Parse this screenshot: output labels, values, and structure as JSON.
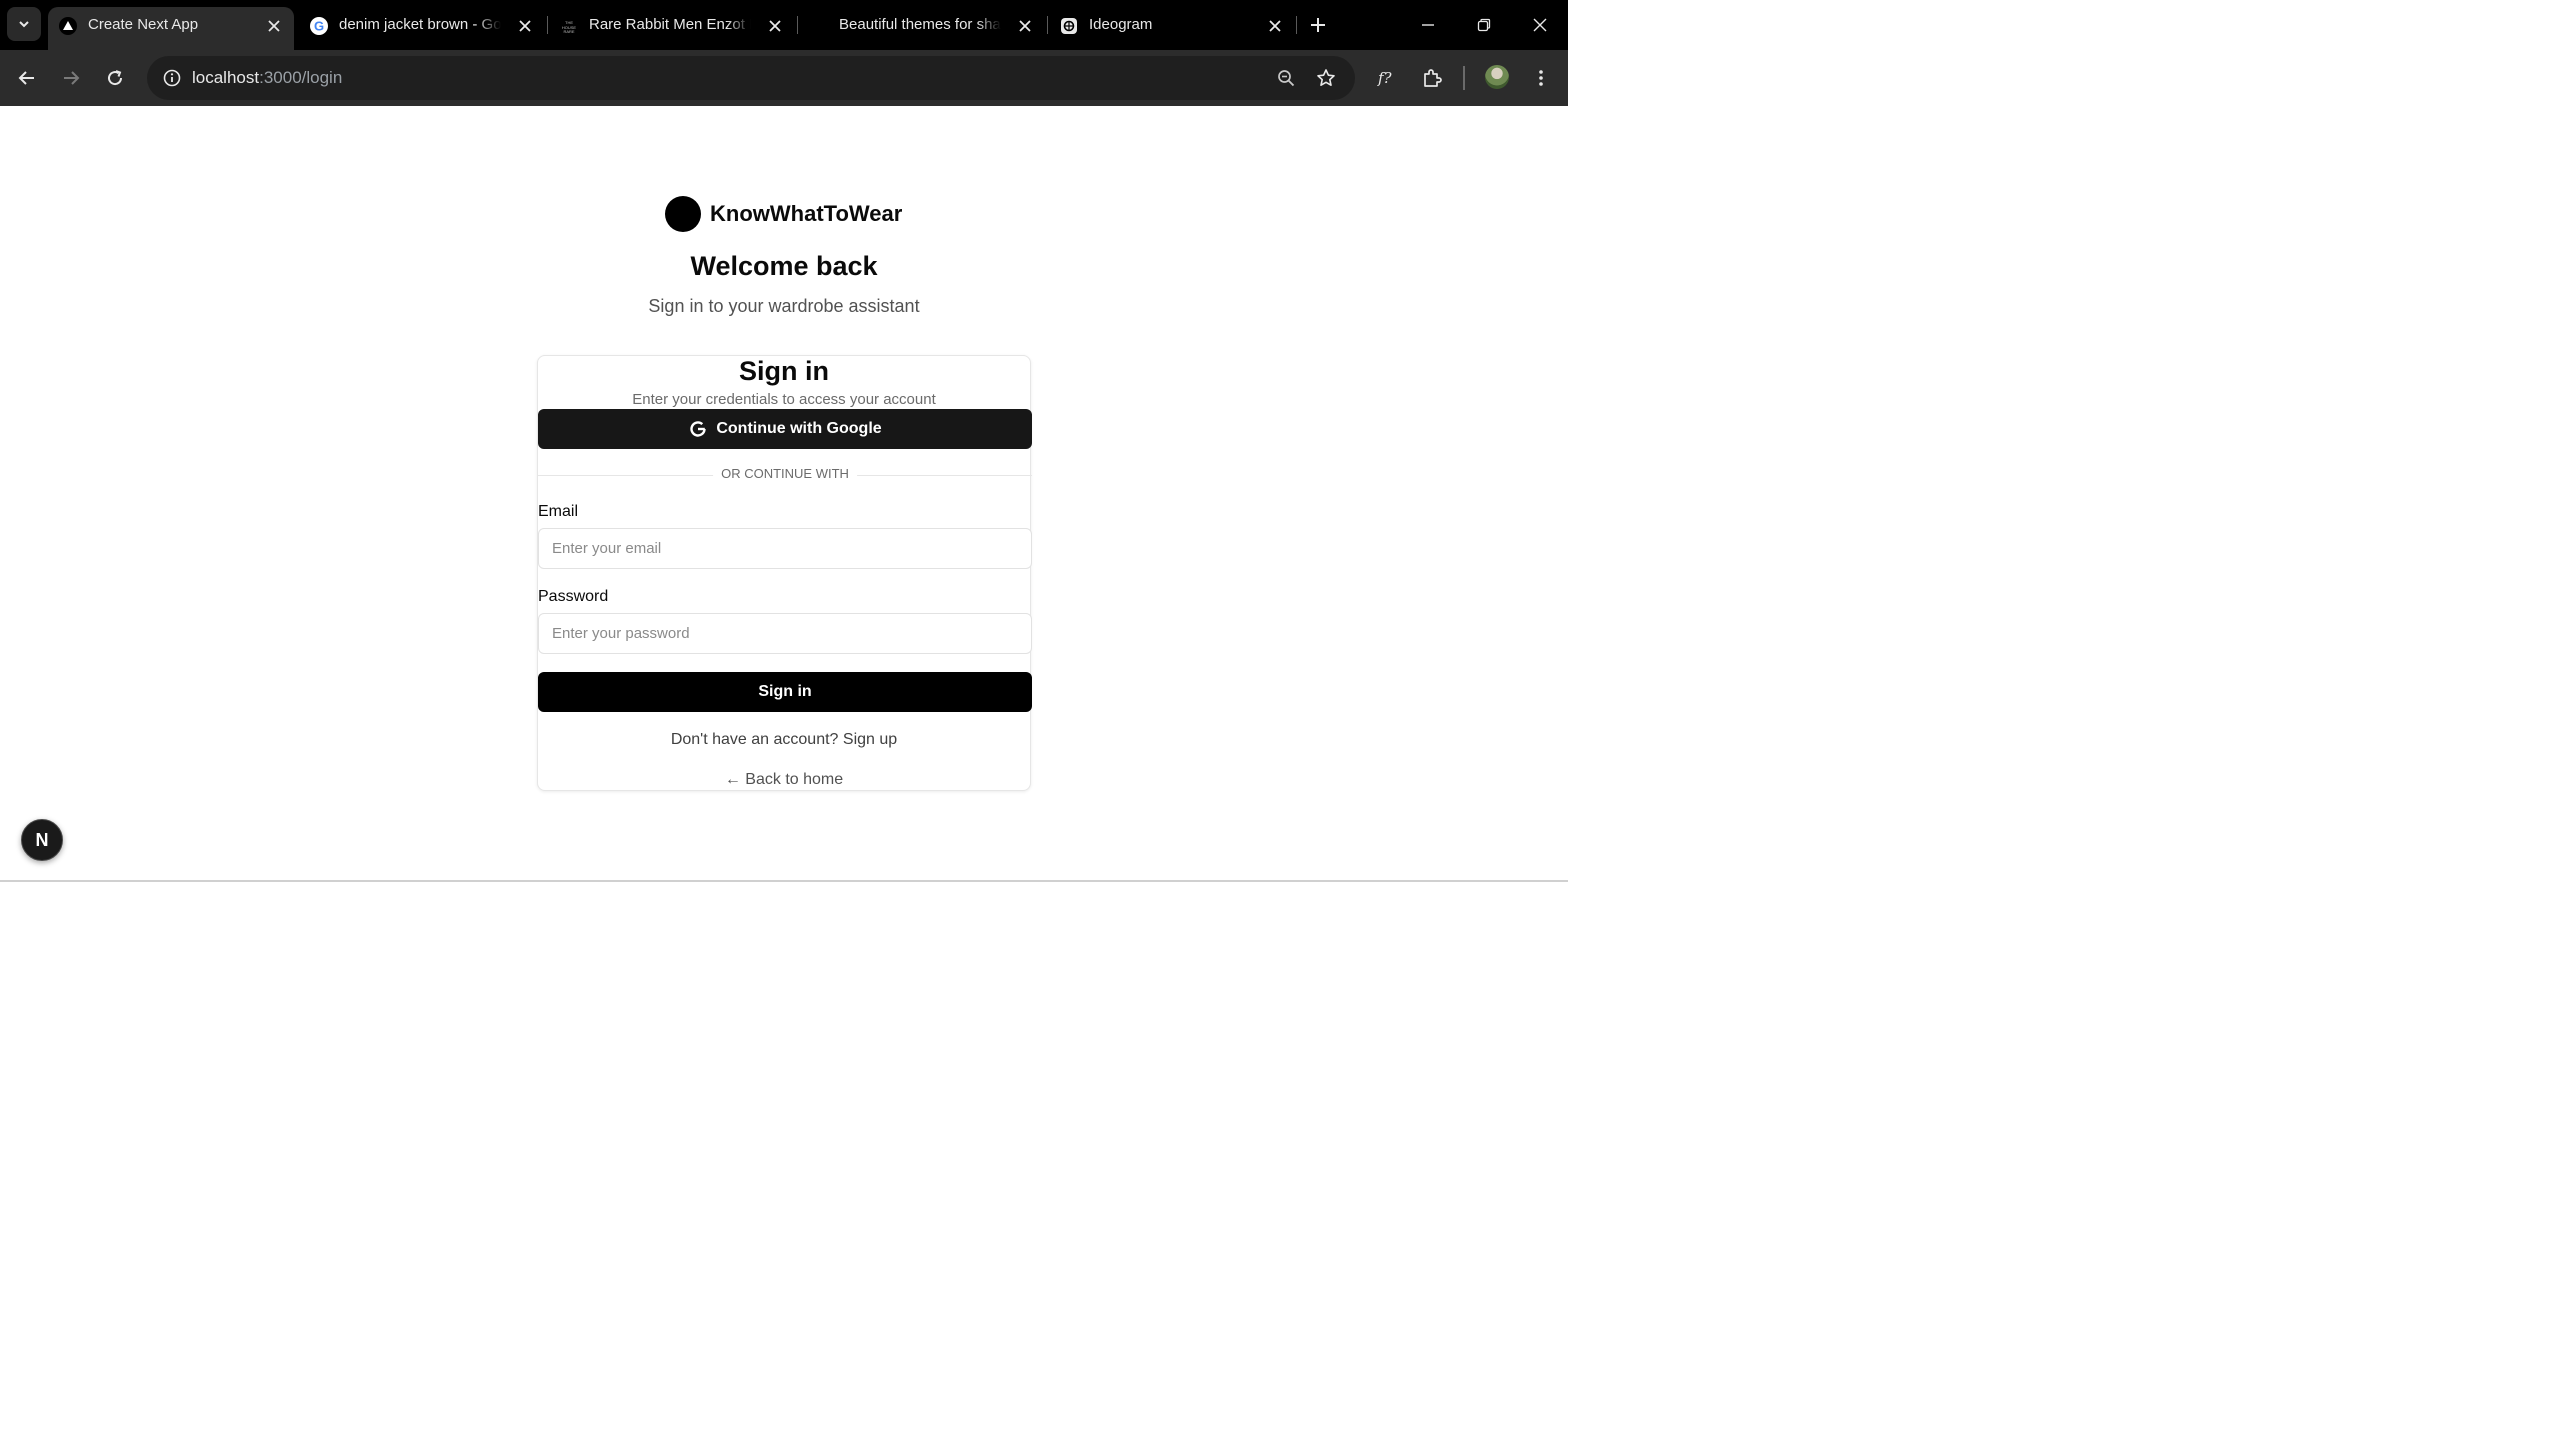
{
  "browser": {
    "tabs": [
      {
        "title": "Create Next App",
        "favicon": "vercel-triangle-icon",
        "active": true
      },
      {
        "title": "denim jacket brown - Go",
        "favicon": "google-g-icon",
        "active": false
      },
      {
        "title": "Rare Rabbit Men Enzot B",
        "favicon": "house-of-rare-icon",
        "active": false
      },
      {
        "title": "Beautiful themes for sha",
        "favicon": "",
        "active": false
      },
      {
        "title": "Ideogram",
        "favicon": "ideogram-icon",
        "active": false
      }
    ],
    "address": {
      "host": "localhost",
      "path": ":3000/login"
    },
    "colors": {
      "tabstrip": "#000000",
      "toolbar": "#2c2c2c",
      "omnibox": "#1f1f1f"
    }
  },
  "page": {
    "brand_name": "KnowWhatToWear",
    "welcome_title": "Welcome back",
    "welcome_subtitle": "Sign in to your wardrobe assistant",
    "card": {
      "title": "Sign in",
      "description": "Enter your credentials to access your account",
      "google_button": "Continue with Google",
      "divider_text": "OR CONTINUE WITH",
      "email_label": "Email",
      "email_placeholder": "Enter your email",
      "email_value": "",
      "password_label": "Password",
      "password_placeholder": "Enter your password",
      "password_value": "",
      "submit_label": "Sign in",
      "signup_text": "Don't have an account? Sign up",
      "back_home_text": "← Back to home"
    },
    "next_badge": "N",
    "colors": {
      "primary_button": "#000000",
      "google_button": "#171717",
      "muted_text": "#6b6b6b"
    }
  }
}
